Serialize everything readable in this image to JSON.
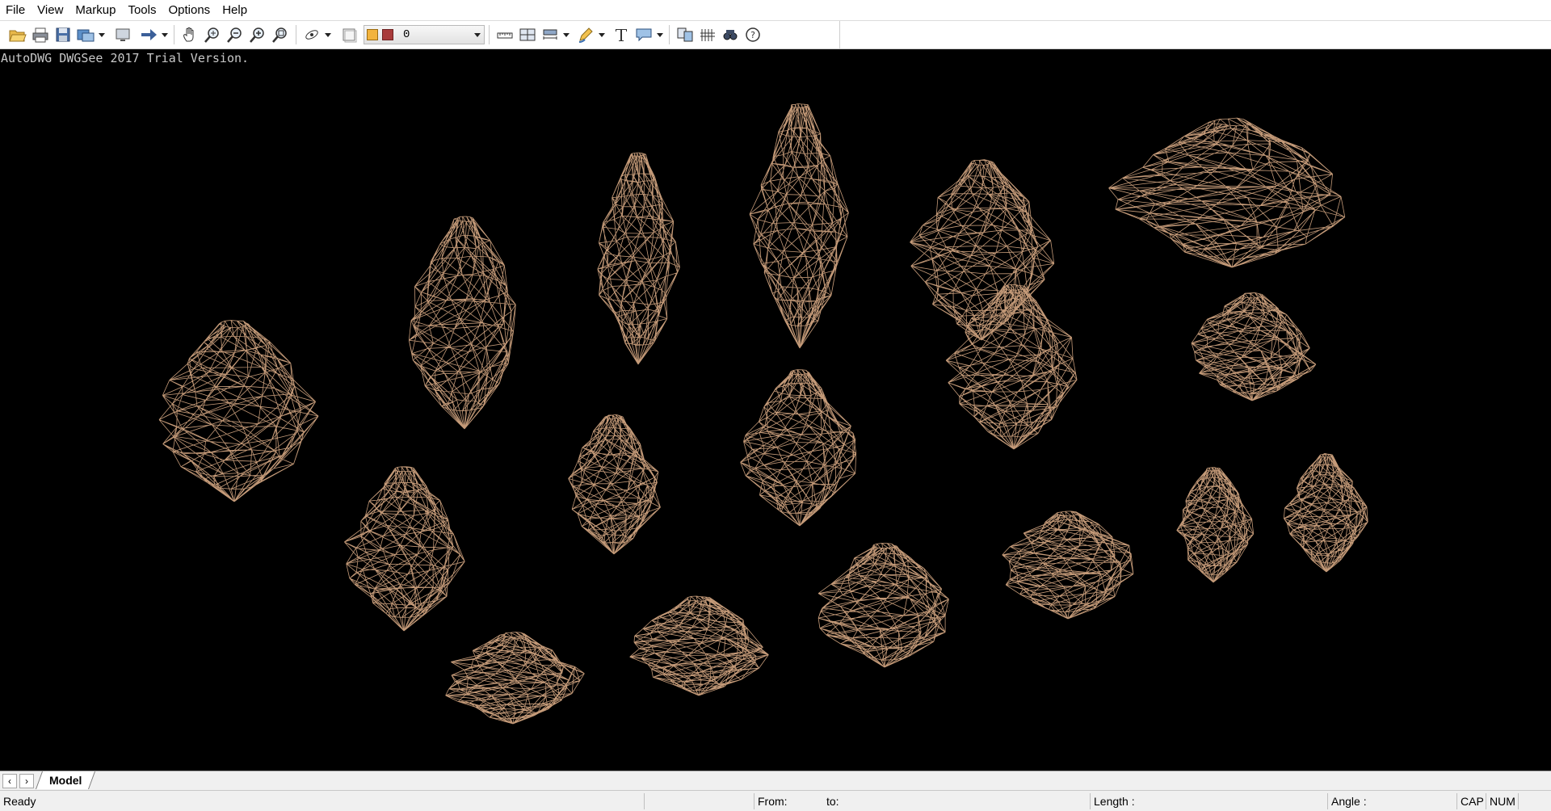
{
  "menu": [
    "File",
    "View",
    "Markup",
    "Tools",
    "Options",
    "Help"
  ],
  "toolbar": {
    "icons": [
      "open-icon",
      "print-icon",
      "save-icon",
      "export-icon",
      "display-icon",
      "arrow-icon",
      "pan-icon",
      "zoom-realtime-icon",
      "zoom-out-icon",
      "zoom-in-icon",
      "zoom-window-icon",
      "orbit-icon",
      "layer-panel-icon",
      "measure-distance-icon",
      "measure-area-icon",
      "dimension-icon",
      "pen-markup-icon",
      "text-icon",
      "callout-icon",
      "compare-icon",
      "hatch-icon",
      "find-icon",
      "help-icon"
    ],
    "layer_value": "0",
    "layer_color": "#a83b3b"
  },
  "canvas": {
    "watermark": "AutoDWG DWGSee 2017 Trial Version.",
    "background": "#000000",
    "wire_color": "#c49a78"
  },
  "tabs": {
    "active": "Model"
  },
  "status": {
    "ready": "Ready",
    "from_label": "From:",
    "to_label": "to:",
    "length_label": "Length :",
    "angle_label": "Angle :",
    "cap": "CAP",
    "num": "NUM"
  }
}
